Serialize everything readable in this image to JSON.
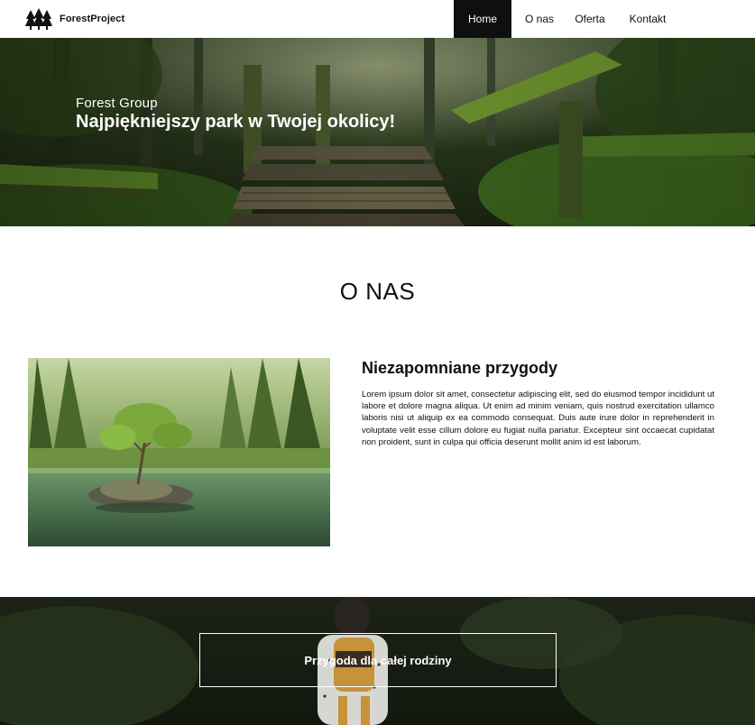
{
  "brand": {
    "name": "ForestProject",
    "logo": "pine-trees-icon"
  },
  "nav": {
    "items": [
      {
        "label": "Home",
        "active": true
      },
      {
        "label": "O nas",
        "active": false
      },
      {
        "label": "Oferta",
        "active": false
      },
      {
        "label": "Kontakt",
        "active": false
      }
    ]
  },
  "hero": {
    "subtitle": "Forest Group",
    "title": "Najpiękniejszy park w Twojej okolicy!"
  },
  "about": {
    "section_title": "O NAS",
    "heading": "Niezapomniane przygody",
    "body": "Lorem ipsum dolor sit amet, consectetur adipiscing elit, sed do eiusmod tempor incididunt ut labore et dolore magna aliqua. Ut enim ad minim veniam, quis nostrud exercitation ullamco laboris nisi ut aliquip ex ea commodo consequat. Duis aute irure dolor in reprehenderit in voluptate velit esse cillum dolore eu fugiat nulla pariatur. Excepteur sint occaecat cupidatat non proident, sunt in culpa qui officia deserunt mollit anim id est laborum."
  },
  "family": {
    "cta_label": "Przygoda dla całej rodziny"
  },
  "colors": {
    "nav_active_bg": "#0f0f0f",
    "text": "#111111",
    "forest_green": "#3f6b22"
  }
}
